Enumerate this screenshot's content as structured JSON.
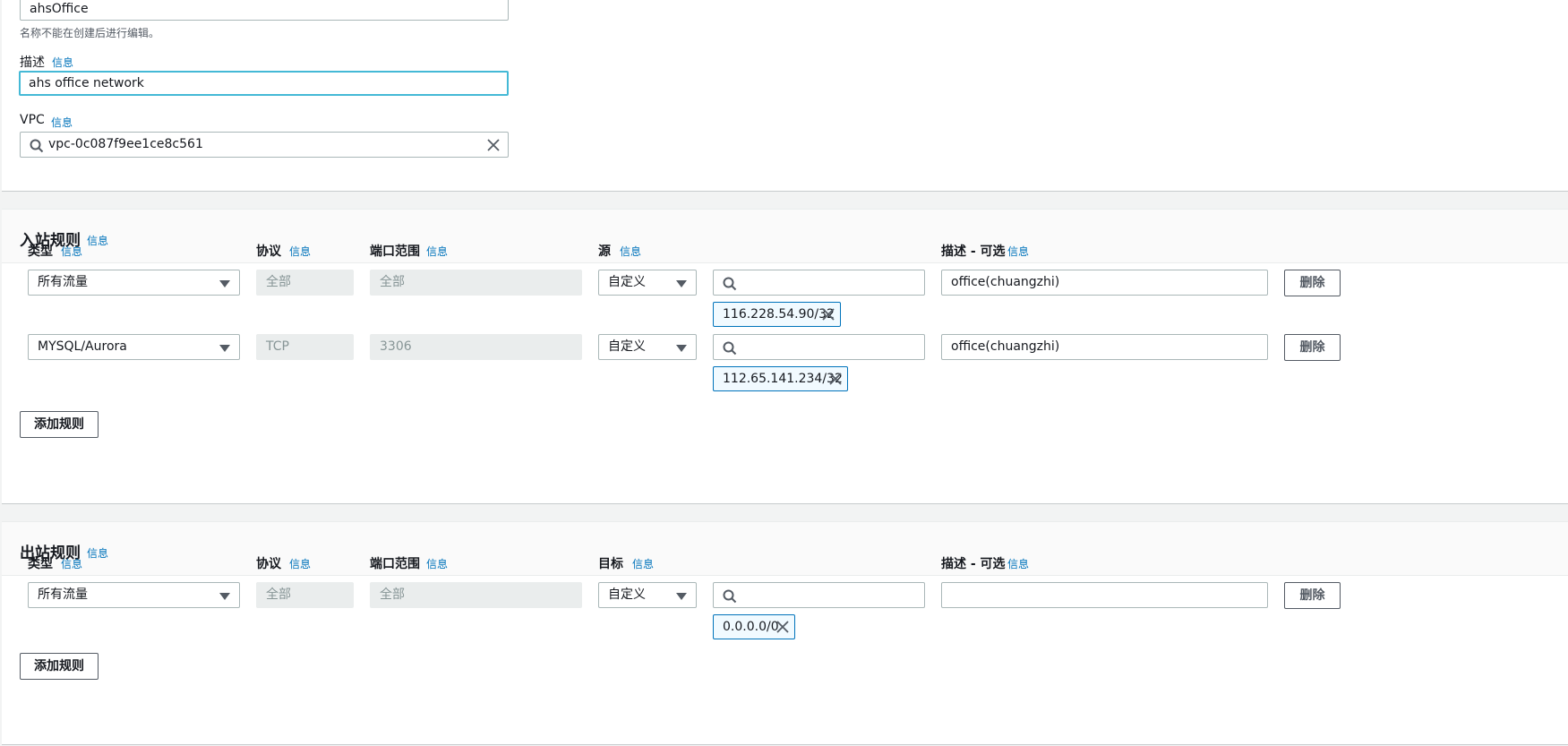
{
  "basic": {
    "name_value": "ahsOffice",
    "name_hint": "名称不能在创建后进行编辑。",
    "desc_label": "描述",
    "desc_value": "ahs office network",
    "vpc_label": "VPC",
    "vpc_value": "vpc-0c087f9ee1ce8c561",
    "info": "信息"
  },
  "inbound": {
    "title": "入站规则",
    "info": "信息",
    "col_type": "类型",
    "col_protocol": "协议",
    "col_port": "端口范围",
    "col_source": "源",
    "col_desc": "描述 - 可选",
    "rows": [
      {
        "type": "所有流量",
        "protocol": "全部",
        "port": "全部",
        "source_mode": "自定义",
        "token": "116.228.54.90/32",
        "desc": "office(chuangzhi)",
        "delete": "删除"
      },
      {
        "type": "MYSQL/Aurora",
        "protocol": "TCP",
        "port": "3306",
        "source_mode": "自定义",
        "token": "112.65.141.234/32",
        "desc": "office(chuangzhi)",
        "delete": "删除"
      }
    ],
    "add_rule": "添加规则"
  },
  "outbound": {
    "title": "出站规则",
    "info": "信息",
    "col_type": "类型",
    "col_protocol": "协议",
    "col_port": "端口范围",
    "col_target": "目标",
    "col_desc": "描述 - 可选",
    "rows": [
      {
        "type": "所有流量",
        "protocol": "全部",
        "port": "全部",
        "target_mode": "自定义",
        "token": "0.0.0.0/0",
        "desc": "",
        "delete": "删除"
      }
    ],
    "add_rule": "添加规则"
  },
  "colors": {
    "info_link": "#0073bb",
    "focus_border": "#44b9d6",
    "token_border": "#0073bb"
  }
}
